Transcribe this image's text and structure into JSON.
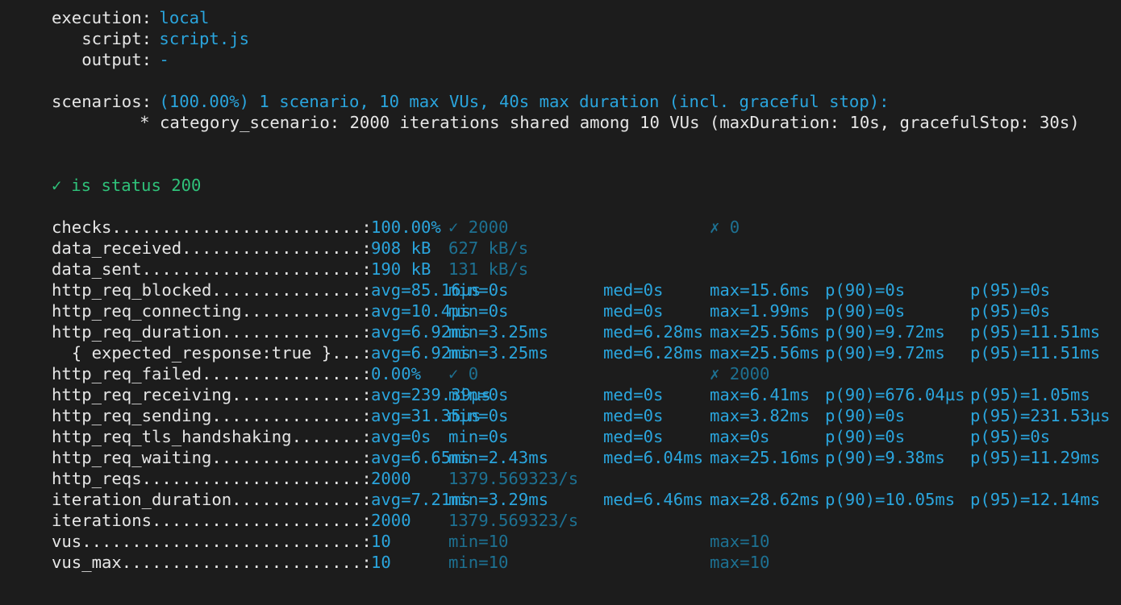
{
  "header": [
    {
      "label": "execution:",
      "value": "local"
    },
    {
      "label": "   script:",
      "value": "script.js"
    },
    {
      "label": "   output:",
      "value": "-"
    }
  ],
  "scenarios": {
    "label": "scenarios:",
    "summary": "(100.00%) 1 scenario, 10 max VUs, 40s max duration (incl. graceful stop):",
    "detail": "* category_scenario: 2000 iterations shared among 10 VUs (maxDuration: 10s, gracefulStop: 30s)"
  },
  "check_result": {
    "mark": "✓",
    "text": "is status 200"
  },
  "metrics": [
    {
      "name": "checks",
      "leader": "checks.........................:",
      "cols": [
        "100.00%",
        "✓ 2000",
        "",
        "✗ 0",
        "",
        ""
      ]
    },
    {
      "name": "data_received",
      "leader": "data_received..................:",
      "cols": [
        "908 kB",
        "627 kB/s",
        "",
        "",
        "",
        ""
      ]
    },
    {
      "name": "data_sent",
      "leader": "data_sent......................:",
      "cols": [
        "190 kB",
        "131 kB/s",
        "",
        "",
        "",
        ""
      ]
    },
    {
      "name": "http_req_blocked",
      "leader": "http_req_blocked...............:",
      "cols": [
        "avg=85.16µs",
        "min=0s",
        "med=0s",
        "max=15.6ms",
        "p(90)=0s",
        "p(95)=0s"
      ]
    },
    {
      "name": "http_req_connecting",
      "leader": "http_req_connecting............:",
      "cols": [
        "avg=10.4µs",
        "min=0s",
        "med=0s",
        "max=1.99ms",
        "p(90)=0s",
        "p(95)=0s"
      ]
    },
    {
      "name": "http_req_duration",
      "leader": "http_req_duration..............:",
      "cols": [
        "avg=6.92ms",
        "min=3.25ms",
        "med=6.28ms",
        "max=25.56ms",
        "p(90)=9.72ms",
        "p(95)=11.51ms"
      ]
    },
    {
      "name": "expected_response",
      "leader": "  { expected_response:true }...:",
      "cols": [
        "avg=6.92ms",
        "min=3.25ms",
        "med=6.28ms",
        "max=25.56ms",
        "p(90)=9.72ms",
        "p(95)=11.51ms"
      ]
    },
    {
      "name": "http_req_failed",
      "leader": "http_req_failed................:",
      "cols": [
        "0.00%",
        "✓ 0",
        "",
        "✗ 2000",
        "",
        ""
      ]
    },
    {
      "name": "http_req_receiving",
      "leader": "http_req_receiving.............:",
      "cols": [
        "avg=239.39µs",
        "min=0s",
        "med=0s",
        "max=6.41ms",
        "p(90)=676.04µs",
        "p(95)=1.05ms"
      ]
    },
    {
      "name": "http_req_sending",
      "leader": "http_req_sending...............:",
      "cols": [
        "avg=31.35µs",
        "min=0s",
        "med=0s",
        "max=3.82ms",
        "p(90)=0s",
        "p(95)=231.53µs"
      ]
    },
    {
      "name": "http_req_tls_handshaking",
      "leader": "http_req_tls_handshaking.......:",
      "cols": [
        "avg=0s",
        "min=0s",
        "med=0s",
        "max=0s",
        "p(90)=0s",
        "p(95)=0s"
      ]
    },
    {
      "name": "http_req_waiting",
      "leader": "http_req_waiting...............:",
      "cols": [
        "avg=6.65ms",
        "min=2.43ms",
        "med=6.04ms",
        "max=25.16ms",
        "p(90)=9.38ms",
        "p(95)=11.29ms"
      ]
    },
    {
      "name": "http_reqs",
      "leader": "http_reqs......................:",
      "cols": [
        "2000",
        "1379.569323/s",
        "",
        "",
        "",
        ""
      ]
    },
    {
      "name": "iteration_duration",
      "leader": "iteration_duration.............:",
      "cols": [
        "avg=7.21ms",
        "min=3.29ms",
        "med=6.46ms",
        "max=28.62ms",
        "p(90)=10.05ms",
        "p(95)=12.14ms"
      ]
    },
    {
      "name": "iterations",
      "leader": "iterations.....................:",
      "cols": [
        "2000",
        "1379.569323/s",
        "",
        "",
        "",
        ""
      ]
    },
    {
      "name": "vus",
      "leader": "vus............................:",
      "cols": [
        "10",
        "min=10",
        "",
        "max=10",
        "",
        ""
      ]
    },
    {
      "name": "vus_max",
      "leader": "vus_max........................:",
      "cols": [
        "10",
        "min=10",
        "",
        "max=10",
        "",
        ""
      ]
    }
  ],
  "colors": {
    "background": "#1c1c1c",
    "text": "#e6e6e6",
    "value": "#2aa5dd",
    "dim_value": "#1d7192",
    "success": "#2fc27a"
  }
}
